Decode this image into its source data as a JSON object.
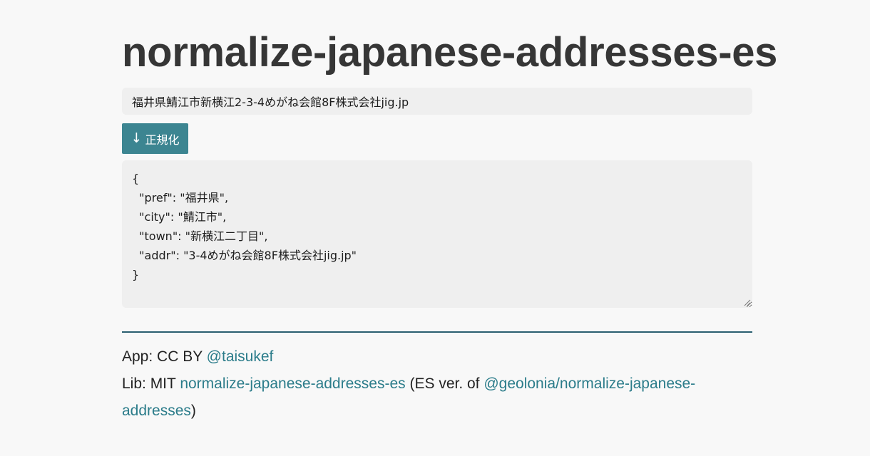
{
  "page": {
    "title": "normalize-japanese-addresses-es"
  },
  "form": {
    "address_value": "福井県鯖江市新横江2-3-4めがね会館8F株式会社jig.jp",
    "normalize_arrow": "↓",
    "normalize_label": "正規化",
    "result_text": "{\n  \"pref\": \"福井県\",\n  \"city\": \"鯖江市\",\n  \"town\": \"新横江二丁目\",\n  \"addr\": \"3-4めがね会館8F株式会社jig.jp\"\n}"
  },
  "footer": {
    "app_prefix": "App: CC BY ",
    "app_link": "@taisukef",
    "lib_prefix": "Lib: MIT ",
    "lib_link": "normalize-japanese-addresses-es",
    "lib_middle": " (ES ver. of ",
    "origin_link": "@geolonia/normalize-japanese-addresses",
    "lib_suffix": ")"
  },
  "colors": {
    "accent": "#3c8591",
    "link": "#2b7c8a",
    "divider": "#2a5f70",
    "field_bg": "#efefef",
    "page_bg": "#f8f8f8"
  },
  "icons": {
    "normalize_button_icon": "down-arrow-icon",
    "textarea_handle": "resize-grip-icon"
  }
}
